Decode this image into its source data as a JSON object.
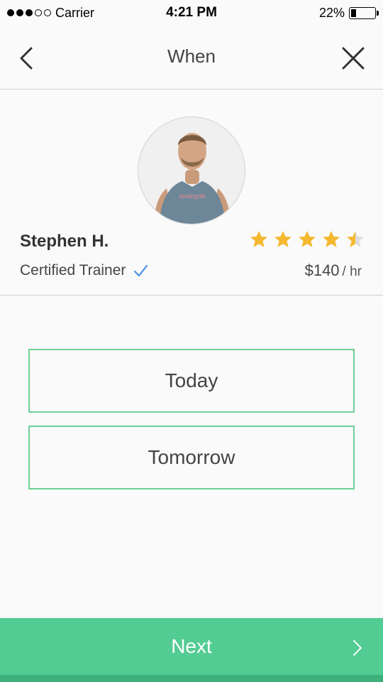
{
  "status_bar": {
    "carrier": "Carrier",
    "time": "4:21 PM",
    "battery": "22%",
    "battery_level": 0.22,
    "signal_filled": 3,
    "signal_total": 5
  },
  "nav": {
    "title": "When",
    "back_icon": "chevron-left-icon",
    "close_icon": "close-icon"
  },
  "trainer": {
    "name": "Stephen H.",
    "certification": "Certified Trainer",
    "verified_icon": "checkmark-icon",
    "rating": 4.5,
    "rating_max": 5,
    "price": "$140",
    "price_unit": "/ hr",
    "avatar_shirt_text": "soulcycle"
  },
  "options": {
    "today_label": "Today",
    "tomorrow_label": "Tomorrow"
  },
  "footer": {
    "next_label": "Next",
    "next_icon": "chevron-right-icon"
  },
  "colors": {
    "accent_green": "#52cc93",
    "option_border": "#6fcf97",
    "star_yellow": "#f5b82e",
    "check_blue": "#4a90e2"
  }
}
